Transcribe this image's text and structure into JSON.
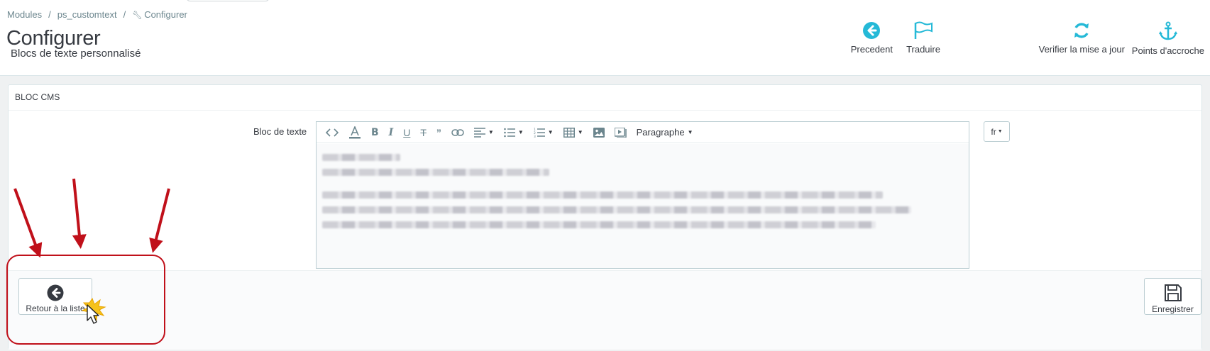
{
  "breadcrumb": {
    "items": [
      "Modules",
      "ps_customtext",
      "Configurer"
    ]
  },
  "page": {
    "title": "Configurer",
    "subtitle": "Blocs de texte personnalisé"
  },
  "toolbar": {
    "back_label": "Precedent",
    "translate_label": "Traduire",
    "check_update_label": "Verifier la mise a jour",
    "hooks_label": "Points d'accroche"
  },
  "panel": {
    "heading": "BLOC CMS",
    "field_label": "Bloc de texte",
    "editor_format_label": "Paragraphe",
    "language": "fr",
    "back_to_list_label": "Retour à la liste",
    "save_label": "Enregistrer"
  },
  "colors": {
    "accent": "#25b9d7",
    "annotation_red": "#c0101a"
  },
  "icons": [
    "arrow-left-circle-icon",
    "flag-icon",
    "refresh-icon",
    "anchor-icon",
    "code-icon",
    "text-color-icon",
    "bold-icon",
    "italic-icon",
    "underline-icon",
    "strikethrough-icon",
    "quote-icon",
    "link-icon",
    "align-icon",
    "bullet-list-icon",
    "numbered-list-icon",
    "table-icon",
    "image-icon",
    "video-icon",
    "save-icon",
    "cursor-icon"
  ]
}
